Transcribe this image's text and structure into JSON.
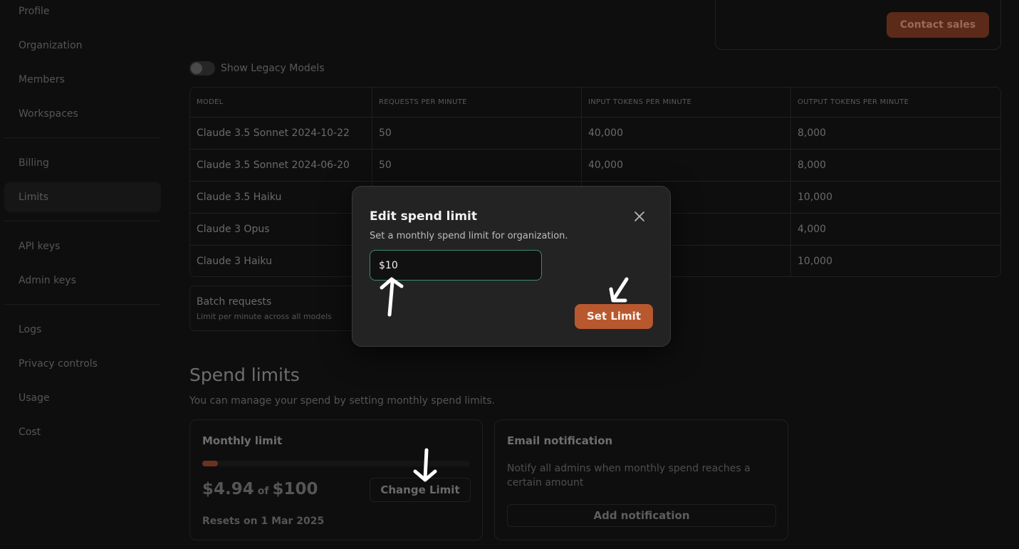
{
  "sidebar": {
    "items": [
      {
        "label": "Profile",
        "top": 0
      },
      {
        "label": "Organization"
      },
      {
        "label": "Members"
      },
      {
        "label": "Workspaces"
      },
      {
        "label": "Billing"
      },
      {
        "label": "Limits"
      },
      {
        "label": "API keys"
      },
      {
        "label": "Admin keys"
      },
      {
        "label": "Logs"
      },
      {
        "label": "Privacy controls"
      },
      {
        "label": "Usage"
      },
      {
        "label": "Cost"
      }
    ],
    "active": "Limits"
  },
  "header": {
    "contact_sales_label": "Contact sales"
  },
  "legacy": {
    "label": "Show Legacy Models",
    "enabled": false
  },
  "rate_table": {
    "columns": [
      "MODEL",
      "REQUESTS PER MINUTE",
      "INPUT TOKENS PER MINUTE",
      "OUTPUT TOKENS PER MINUTE"
    ],
    "rows": [
      [
        "Claude 3.5 Sonnet 2024-10-22",
        "50",
        "40,000",
        "8,000"
      ],
      [
        "Claude 3.5 Sonnet 2024-06-20",
        "50",
        "40,000",
        "8,000"
      ],
      [
        "Claude 3.5 Haiku",
        "",
        "",
        "10,000"
      ],
      [
        "Claude 3 Opus",
        "",
        "",
        "4,000"
      ],
      [
        "Claude 3 Haiku",
        "",
        "",
        "10,000"
      ]
    ]
  },
  "batch": {
    "title": "Batch requests",
    "subtitle": "Limit per minute across all models"
  },
  "spend": {
    "title": "Spend limits",
    "description": "You can manage your spend by setting monthly spend limits.",
    "monthly": {
      "title": "Monthly limit",
      "spent": "$4.94",
      "of": "of",
      "limit": "$100",
      "progress_fraction": 0.0494,
      "change_label": "Change Limit",
      "resets": "Resets on 1 Mar 2025"
    },
    "email": {
      "title": "Email notification",
      "description": "Notify all admins when monthly spend reaches a certain amount",
      "add_label": "Add notification"
    }
  },
  "modal": {
    "title": "Edit spend limit",
    "description": "Set a monthly spend limit for organization.",
    "input_value": "$10",
    "submit_label": "Set Limit"
  },
  "colors": {
    "accent": "#b8582f",
    "input_focus_border": "#3d8a6d",
    "background": "#0e0e0e"
  }
}
